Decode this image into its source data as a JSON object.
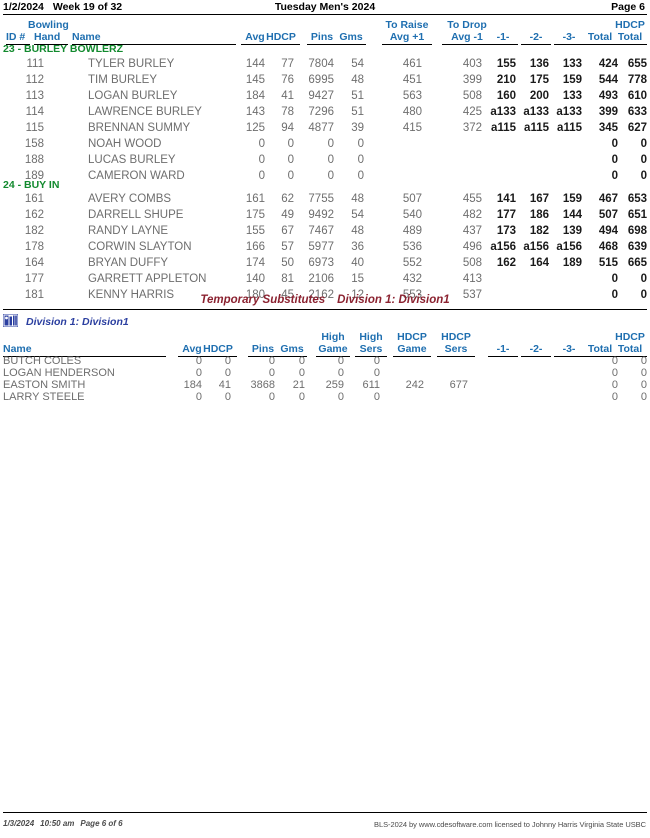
{
  "header": {
    "date": "1/2/2024",
    "week": "Week 19 of 32",
    "title": "Tuesday Men's 2024",
    "page": "Page 6"
  },
  "main_table": {
    "columns": {
      "id": "ID #",
      "bowling": "Bowling",
      "hand": "Hand",
      "name": "Name",
      "avg": "Avg",
      "hdcp": "HDCP",
      "pins": "Pins",
      "gms": "Gms",
      "to_raise": "To Raise",
      "avg_plus_1": "Avg +1",
      "to_drop": "To Drop",
      "avg_minus_1": "Avg -1",
      "g1": "-1-",
      "g2": "-2-",
      "g3": "-3-",
      "total": "Total",
      "hdcp_total_top": "HDCP",
      "hdcp_total": "Total"
    },
    "teams": [
      {
        "name": "23 - BURLEY BOWLERZ",
        "rows": [
          {
            "id": "111",
            "name": "TYLER BURLEY",
            "avg": "144",
            "hdcp": "77",
            "pins": "7804",
            "gms": "54",
            "raise": "461",
            "drop": "403",
            "g1": "155",
            "g2": "136",
            "g3": "133",
            "total": "424",
            "hdcp_total": "655"
          },
          {
            "id": "112",
            "name": "TIM BURLEY",
            "avg": "145",
            "hdcp": "76",
            "pins": "6995",
            "gms": "48",
            "raise": "451",
            "drop": "399",
            "g1": "210",
            "g2": "175",
            "g3": "159",
            "total": "544",
            "hdcp_total": "778"
          },
          {
            "id": "113",
            "name": "LOGAN BURLEY",
            "avg": "184",
            "hdcp": "41",
            "pins": "9427",
            "gms": "51",
            "raise": "563",
            "drop": "508",
            "g1": "160",
            "g2": "200",
            "g3": "133",
            "total": "493",
            "hdcp_total": "610"
          },
          {
            "id": "114",
            "name": "LAWRENCE BURLEY",
            "avg": "143",
            "hdcp": "78",
            "pins": "7296",
            "gms": "51",
            "raise": "480",
            "drop": "425",
            "g1": "a133",
            "g2": "a133",
            "g3": "a133",
            "total": "399",
            "hdcp_total": "633"
          },
          {
            "id": "115",
            "name": "BRENNAN SUMMY",
            "avg": "125",
            "hdcp": "94",
            "pins": "4877",
            "gms": "39",
            "raise": "415",
            "drop": "372",
            "g1": "a115",
            "g2": "a115",
            "g3": "a115",
            "total": "345",
            "hdcp_total": "627"
          },
          {
            "id": "158",
            "name": "NOAH WOOD",
            "avg": "0",
            "hdcp": "0",
            "pins": "0",
            "gms": "0",
            "raise": "",
            "drop": "",
            "g1": "",
            "g2": "",
            "g3": "",
            "total": "0",
            "hdcp_total": "0"
          },
          {
            "id": "188",
            "name": "LUCAS BURLEY",
            "avg": "0",
            "hdcp": "0",
            "pins": "0",
            "gms": "0",
            "raise": "",
            "drop": "",
            "g1": "",
            "g2": "",
            "g3": "",
            "total": "0",
            "hdcp_total": "0"
          },
          {
            "id": "189",
            "name": "CAMERON WARD",
            "avg": "0",
            "hdcp": "0",
            "pins": "0",
            "gms": "0",
            "raise": "",
            "drop": "",
            "g1": "",
            "g2": "",
            "g3": "",
            "total": "0",
            "hdcp_total": "0"
          }
        ]
      },
      {
        "name": "24 - BUY IN",
        "rows": [
          {
            "id": "161",
            "name": "AVERY COMBS",
            "avg": "161",
            "hdcp": "62",
            "pins": "7755",
            "gms": "48",
            "raise": "507",
            "drop": "455",
            "g1": "141",
            "g2": "167",
            "g3": "159",
            "total": "467",
            "hdcp_total": "653"
          },
          {
            "id": "162",
            "name": "DARRELL SHUPE",
            "avg": "175",
            "hdcp": "49",
            "pins": "9492",
            "gms": "54",
            "raise": "540",
            "drop": "482",
            "g1": "177",
            "g2": "186",
            "g3": "144",
            "total": "507",
            "hdcp_total": "651"
          },
          {
            "id": "182",
            "name": "RANDY LAYNE",
            "avg": "155",
            "hdcp": "67",
            "pins": "7467",
            "gms": "48",
            "raise": "489",
            "drop": "437",
            "g1": "173",
            "g2": "182",
            "g3": "139",
            "total": "494",
            "hdcp_total": "698"
          },
          {
            "id": "178",
            "name": "CORWIN SLAYTON",
            "avg": "166",
            "hdcp": "57",
            "pins": "5977",
            "gms": "36",
            "raise": "536",
            "drop": "496",
            "g1": "a156",
            "g2": "a156",
            "g3": "a156",
            "total": "468",
            "hdcp_total": "639"
          },
          {
            "id": "164",
            "name": "BRYAN DUFFY",
            "avg": "174",
            "hdcp": "50",
            "pins": "6973",
            "gms": "40",
            "raise": "552",
            "drop": "508",
            "g1": "162",
            "g2": "164",
            "g3": "189",
            "total": "515",
            "hdcp_total": "665"
          },
          {
            "id": "177",
            "name": "GARRETT APPLETON",
            "avg": "140",
            "hdcp": "81",
            "pins": "2106",
            "gms": "15",
            "raise": "432",
            "drop": "413",
            "g1": "",
            "g2": "",
            "g3": "",
            "total": "0",
            "hdcp_total": "0"
          },
          {
            "id": "181",
            "name": "KENNY HARRIS",
            "avg": "180",
            "hdcp": "45",
            "pins": "2162",
            "gms": "12",
            "raise": "553",
            "drop": "537",
            "g1": "",
            "g2": "",
            "g3": "",
            "total": "0",
            "hdcp_total": "0"
          }
        ]
      }
    ]
  },
  "subs_section": {
    "banner_left": "Temporary Substitutes",
    "banner_right": "Division 1: Division1",
    "division_label": "Division 1: Division1",
    "division_icon": "bowling-pins-icon",
    "columns": {
      "name": "Name",
      "avg": "Avg",
      "hdcp": "HDCP",
      "pins": "Pins",
      "gms": "Gms",
      "high_top": "High",
      "high_game": "Game",
      "high_sers_top": "High",
      "high_sers": "Sers",
      "hdcp_game_top": "HDCP",
      "hdcp_game": "Game",
      "hdcp_sers_top": "HDCP",
      "hdcp_sers": "Sers",
      "g1": "-1-",
      "g2": "-2-",
      "g3": "-3-",
      "total": "Total",
      "hdcp_total_top": "HDCP",
      "hdcp_total": "Total"
    },
    "rows": [
      {
        "name": "BUTCH COLES",
        "avg": "0",
        "hdcp": "0",
        "pins": "0",
        "gms": "0",
        "high_game": "0",
        "high_sers": "0",
        "hdcp_game": "",
        "hdcp_sers": "",
        "g1": "",
        "g2": "",
        "g3": "",
        "total": "0",
        "hdcp_total": "0"
      },
      {
        "name": "LOGAN HENDERSON",
        "avg": "0",
        "hdcp": "0",
        "pins": "0",
        "gms": "0",
        "high_game": "0",
        "high_sers": "0",
        "hdcp_game": "",
        "hdcp_sers": "",
        "g1": "",
        "g2": "",
        "g3": "",
        "total": "0",
        "hdcp_total": "0"
      },
      {
        "name": "EASTON SMITH",
        "avg": "184",
        "hdcp": "41",
        "pins": "3868",
        "gms": "21",
        "high_game": "259",
        "high_sers": "611",
        "hdcp_game": "242",
        "hdcp_sers": "677",
        "g1": "",
        "g2": "",
        "g3": "",
        "total": "0",
        "hdcp_total": "0"
      },
      {
        "name": "LARRY STEELE",
        "avg": "0",
        "hdcp": "0",
        "pins": "0",
        "gms": "0",
        "high_game": "0",
        "high_sers": "0",
        "hdcp_game": "",
        "hdcp_sers": "",
        "g1": "",
        "g2": "",
        "g3": "",
        "total": "0",
        "hdcp_total": "0"
      }
    ]
  },
  "footer": {
    "date": "1/3/2024",
    "time": "10:50 am",
    "page": "Page 6 of 6",
    "credit": "BLS-2024 by www.cdesoftware.com licensed to Johnny Harris  Virginia State USBC"
  },
  "colors": {
    "team_green": "#128a2e",
    "header_blue": "#1f6fb0",
    "division_blue": "#2b3fa0",
    "subs_red": "#8b2230",
    "data_gray": "#6e6e6e",
    "data_dark": "#1a1a1a"
  }
}
